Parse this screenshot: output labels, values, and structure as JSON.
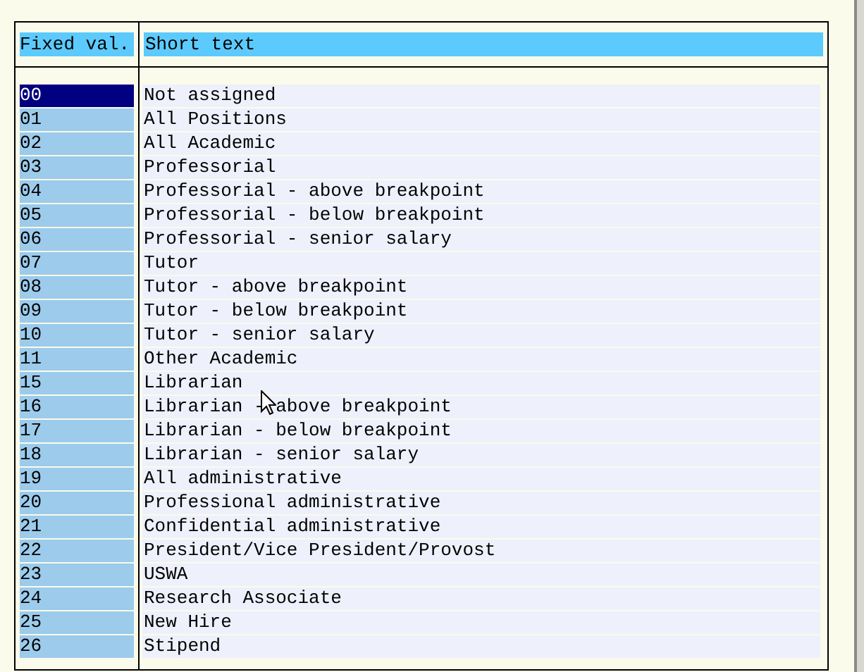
{
  "table": {
    "columns": [
      "Fixed val.",
      "Short text"
    ],
    "rows": [
      {
        "value": "00",
        "text": "Not assigned",
        "selected": true
      },
      {
        "value": "01",
        "text": "All Positions",
        "selected": false
      },
      {
        "value": "02",
        "text": "All Academic",
        "selected": false
      },
      {
        "value": "03",
        "text": "Professorial",
        "selected": false
      },
      {
        "value": "04",
        "text": "Professorial - above breakpoint",
        "selected": false
      },
      {
        "value": "05",
        "text": "Professorial - below breakpoint",
        "selected": false
      },
      {
        "value": "06",
        "text": "Professorial - senior salary",
        "selected": false
      },
      {
        "value": "07",
        "text": "Tutor",
        "selected": false
      },
      {
        "value": "08",
        "text": "Tutor - above breakpoint",
        "selected": false
      },
      {
        "value": "09",
        "text": "Tutor - below breakpoint",
        "selected": false
      },
      {
        "value": "10",
        "text": "Tutor - senior salary",
        "selected": false
      },
      {
        "value": "11",
        "text": "Other Academic",
        "selected": false
      },
      {
        "value": "15",
        "text": "Librarian",
        "selected": false
      },
      {
        "value": "16",
        "text": "Librarian - above breakpoint",
        "selected": false
      },
      {
        "value": "17",
        "text": "Librarian - below breakpoint",
        "selected": false
      },
      {
        "value": "18",
        "text": "Librarian - senior salary",
        "selected": false
      },
      {
        "value": "19",
        "text": "All administrative",
        "selected": false
      },
      {
        "value": "20",
        "text": "Professional administrative",
        "selected": false
      },
      {
        "value": "21",
        "text": "Confidential administrative",
        "selected": false
      },
      {
        "value": "22",
        "text": "President/Vice President/Provost",
        "selected": false
      },
      {
        "value": "23",
        "text": "USWA",
        "selected": false
      },
      {
        "value": "24",
        "text": "Research Associate",
        "selected": false
      },
      {
        "value": "25",
        "text": "New Hire",
        "selected": false
      },
      {
        "value": "26",
        "text": "Stipend",
        "selected": false
      }
    ]
  }
}
